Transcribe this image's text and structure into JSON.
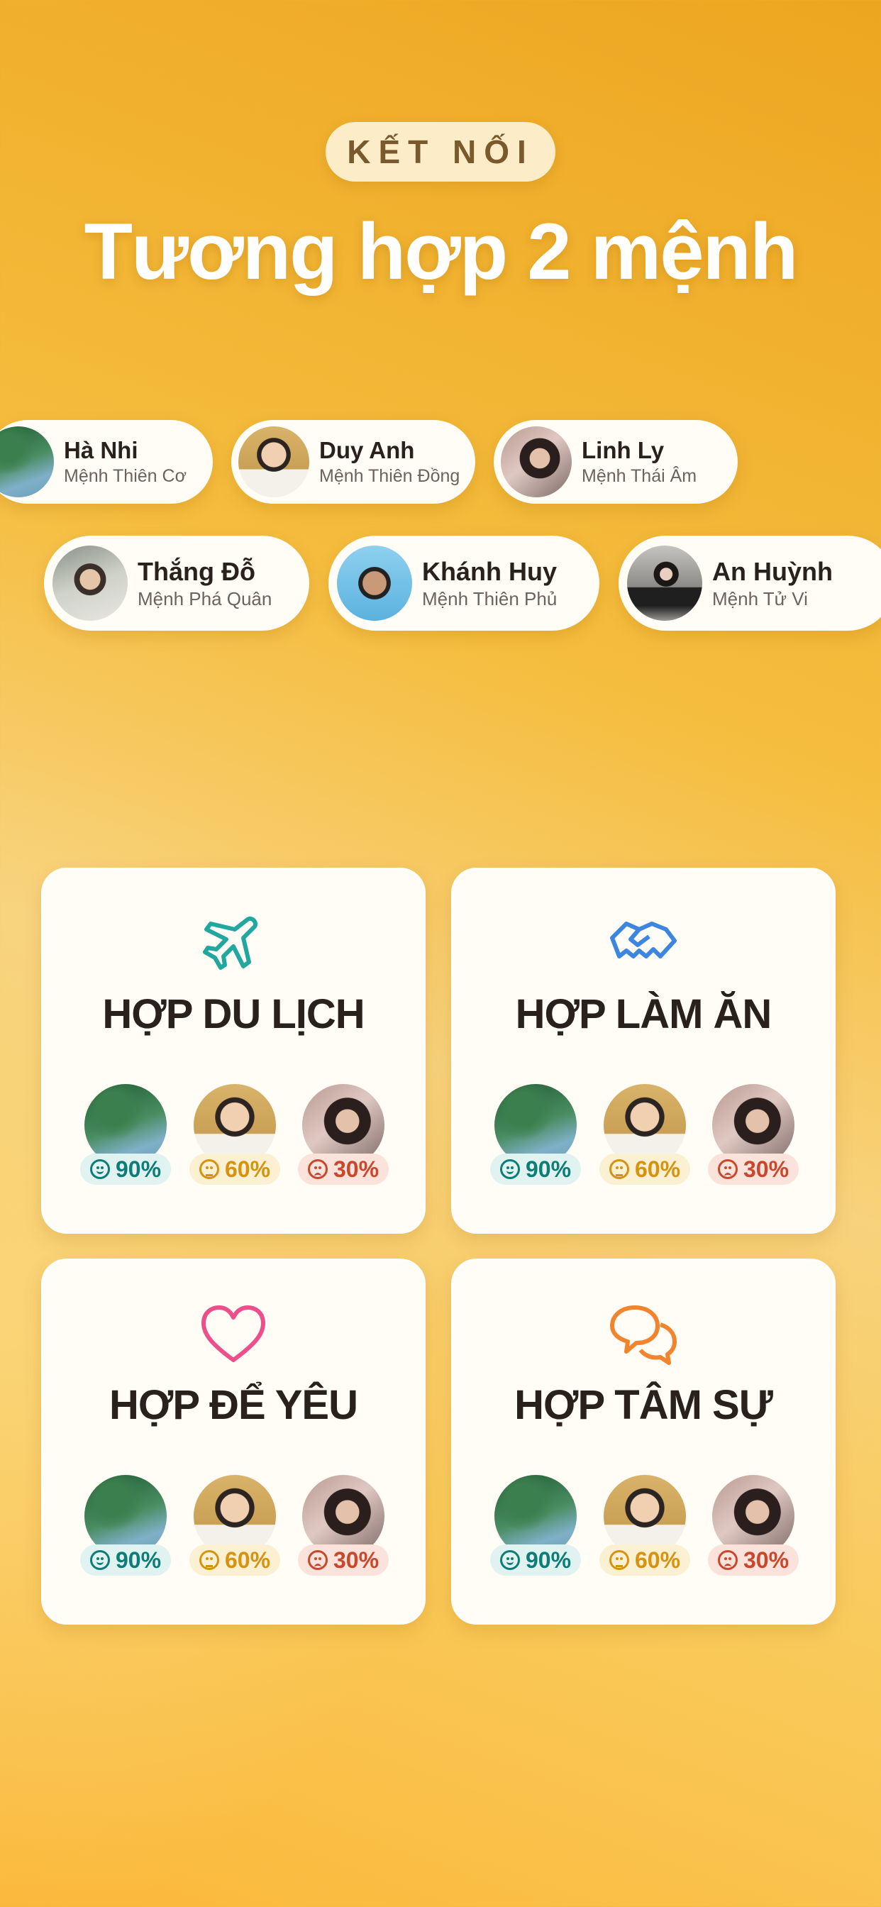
{
  "header": {
    "tag": "KẾT NỐI",
    "title": "Tương hợp 2 mệnh"
  },
  "profiles": [
    {
      "name": "Hà Nhi",
      "destiny": "Mệnh Thiên Cơ"
    },
    {
      "name": "Duy Anh",
      "destiny": "Mệnh Thiên Đồng"
    },
    {
      "name": "Linh Ly",
      "destiny": "Mệnh Thái Âm"
    },
    {
      "name": "Thắng Đỗ",
      "destiny": "Mệnh Phá Quân"
    },
    {
      "name": "Khánh Huy",
      "destiny": "Mệnh Thiên Phủ"
    },
    {
      "name": "An Huỳnh",
      "destiny": "Mệnh Tử Vi"
    }
  ],
  "cards": [
    {
      "title": "HỢP DU LỊCH",
      "icon": "airplane-icon",
      "icon_color": "#1fa7a0",
      "scores": [
        "90%",
        "60%",
        "30%"
      ]
    },
    {
      "title": "HỢP LÀM ĂN",
      "icon": "handshake-icon",
      "icon_color": "#3d86e0",
      "scores": [
        "90%",
        "60%",
        "30%"
      ]
    },
    {
      "title": "HỢP ĐỂ YÊU",
      "icon": "heart-icon",
      "icon_color": "#ec4f8a",
      "scores": [
        "90%",
        "60%",
        "30%"
      ]
    },
    {
      "title": "HỢP TÂM SỰ",
      "icon": "chat-bubbles-icon",
      "icon_color": "#f2842e",
      "scores": [
        "90%",
        "60%",
        "30%"
      ]
    }
  ],
  "colors": {
    "good": "#0e7c77",
    "mid": "#d79210",
    "bad": "#c9482c"
  }
}
